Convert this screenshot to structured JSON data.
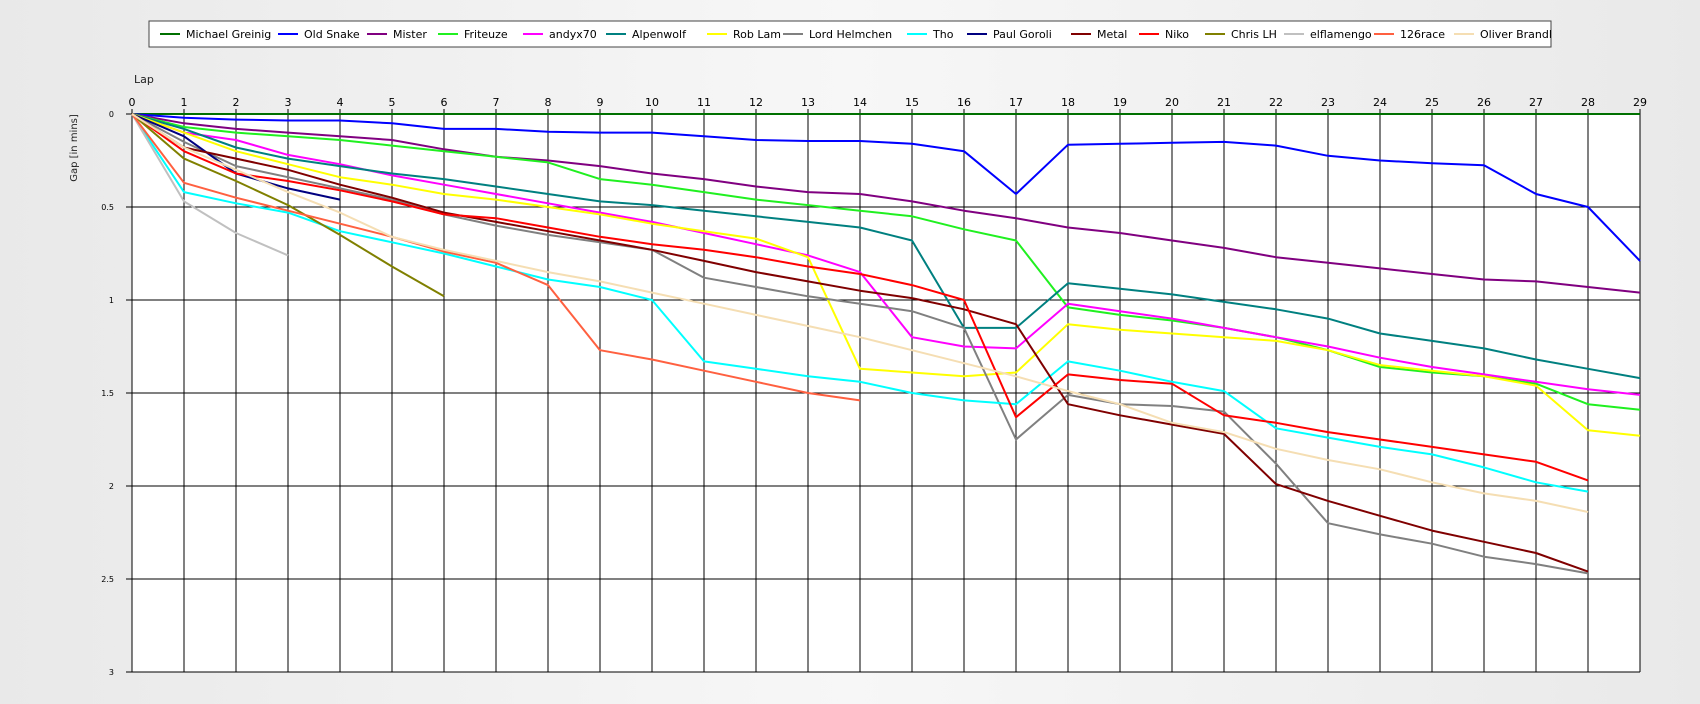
{
  "chart_data": {
    "type": "line",
    "title": "",
    "xlabel": "Lap",
    "ylabel": "Gap [in mins]",
    "xlim": [
      0,
      29
    ],
    "ylim": [
      0,
      3
    ],
    "y_inverted": true,
    "grid": true,
    "legend_position": "top",
    "x": [
      0,
      1,
      2,
      3,
      4,
      5,
      6,
      7,
      8,
      9,
      10,
      11,
      12,
      13,
      14,
      15,
      16,
      17,
      18,
      19,
      20,
      21,
      22,
      23,
      24,
      25,
      26,
      27,
      28,
      29
    ],
    "x_ticks": [
      "0",
      "1",
      "2",
      "3",
      "4",
      "5",
      "6",
      "7",
      "8",
      "9",
      "10",
      "11",
      "12",
      "13",
      "14",
      "15",
      "16",
      "17",
      "18",
      "19",
      "20",
      "21",
      "22",
      "23",
      "24",
      "25",
      "26",
      "27",
      "28",
      "29"
    ],
    "y_ticks": [
      {
        "value": 0,
        "label": "0"
      },
      {
        "value": 0.5,
        "label": "0.5"
      },
      {
        "value": 1,
        "label": "1"
      },
      {
        "value": 1.5,
        "label": "1.5"
      },
      {
        "value": 2,
        "label": "2"
      },
      {
        "value": 2.5,
        "label": "2.5"
      },
      {
        "value": 3,
        "label": "3"
      }
    ],
    "series": [
      {
        "name": "Michael Greinig",
        "color": "#007000",
        "values": [
          0,
          0,
          0,
          0,
          0,
          0,
          0,
          0,
          0,
          0,
          0,
          0,
          0,
          0,
          0,
          0,
          0,
          0,
          0,
          0,
          0,
          0,
          0,
          0,
          0,
          0,
          0,
          0,
          0,
          0
        ]
      },
      {
        "name": "Old Snake",
        "color": "#0000ff",
        "values": [
          0,
          0.02,
          0.03,
          0.035,
          0.035,
          0.05,
          0.08,
          0.08,
          0.095,
          0.1,
          0.1,
          0.12,
          0.14,
          0.145,
          0.145,
          0.16,
          0.2,
          0.43,
          0.165,
          0.16,
          0.155,
          0.15,
          0.17,
          0.225,
          0.25,
          0.265,
          0.275,
          0.43,
          0.5,
          0.79
        ]
      },
      {
        "name": "Mister",
        "color": "#800080",
        "values": [
          0,
          0.05,
          0.08,
          0.1,
          0.12,
          0.14,
          0.19,
          0.23,
          0.25,
          0.28,
          0.32,
          0.35,
          0.39,
          0.42,
          0.43,
          0.47,
          0.52,
          0.56,
          0.61,
          0.64,
          0.68,
          0.72,
          0.77,
          0.8,
          0.83,
          0.86,
          0.89,
          0.9,
          0.93,
          0.96
        ]
      },
      {
        "name": "Friteuze",
        "color": "#20f020",
        "values": [
          0,
          0.07,
          0.1,
          0.12,
          0.14,
          0.17,
          0.2,
          0.23,
          0.26,
          0.35,
          0.38,
          0.42,
          0.46,
          0.49,
          0.52,
          0.55,
          0.62,
          0.68,
          1.04,
          1.08,
          1.11,
          1.15,
          1.2,
          1.27,
          1.36,
          1.39,
          1.41,
          1.45,
          1.56,
          1.59
        ]
      },
      {
        "name": "andyx70",
        "color": "#ff00ff",
        "values": [
          0,
          0.1,
          0.14,
          0.22,
          0.27,
          0.33,
          0.38,
          0.43,
          0.48,
          0.53,
          0.58,
          0.64,
          0.7,
          0.76,
          0.85,
          1.2,
          1.25,
          1.26,
          1.02,
          1.06,
          1.1,
          1.15,
          1.2,
          1.25,
          1.31,
          1.36,
          1.4,
          1.44,
          1.48,
          1.51
        ]
      },
      {
        "name": "Alpenwolf",
        "color": "#008080",
        "values": [
          0,
          0.08,
          0.18,
          0.24,
          0.28,
          0.32,
          0.35,
          0.39,
          0.43,
          0.47,
          0.49,
          0.52,
          0.55,
          0.58,
          0.61,
          0.68,
          1.15,
          1.15,
          0.91,
          0.94,
          0.97,
          1.01,
          1.05,
          1.1,
          1.18,
          1.22,
          1.26,
          1.32,
          1.37,
          1.42
        ]
      },
      {
        "name": "Rob Lam",
        "color": "#ffff00",
        "values": [
          0,
          0.1,
          0.2,
          0.27,
          0.34,
          0.38,
          0.43,
          0.46,
          0.5,
          0.54,
          0.59,
          0.63,
          0.67,
          0.77,
          1.37,
          1.39,
          1.41,
          1.39,
          1.13,
          1.16,
          1.18,
          1.2,
          1.22,
          1.27,
          1.35,
          1.38,
          1.41,
          1.46,
          1.7,
          1.73
        ]
      },
      {
        "name": "Lord Helmchen",
        "color": "#808080",
        "values": [
          0,
          0.15,
          0.28,
          0.34,
          0.4,
          0.46,
          0.54,
          0.6,
          0.65,
          0.69,
          0.73,
          0.88,
          0.93,
          0.98,
          1.02,
          1.06,
          1.15,
          1.75,
          1.51,
          1.56,
          1.57,
          1.6,
          1.88,
          2.2,
          2.26,
          2.31,
          2.38,
          2.42,
          2.47,
          null
        ]
      },
      {
        "name": "Tho",
        "color": "#00ffff",
        "values": [
          0,
          0.42,
          0.48,
          0.53,
          0.63,
          0.69,
          0.75,
          0.82,
          0.89,
          0.93,
          1.0,
          1.33,
          1.37,
          1.41,
          1.44,
          1.5,
          1.54,
          1.56,
          1.33,
          1.38,
          1.44,
          1.49,
          1.69,
          1.74,
          1.79,
          1.83,
          1.9,
          1.98,
          2.03,
          null
        ]
      },
      {
        "name": "Paul Goroli",
        "color": "#000080",
        "values": [
          0,
          0.12,
          0.32,
          0.4,
          0.46,
          null,
          null,
          null,
          null,
          null,
          null,
          null,
          null,
          null,
          null,
          null,
          null,
          null,
          null,
          null,
          null,
          null,
          null,
          null,
          null,
          null,
          null,
          null,
          null,
          null
        ]
      },
      {
        "name": "Metal",
        "color": "#800000",
        "values": [
          0,
          0.18,
          0.24,
          0.3,
          0.38,
          0.45,
          0.53,
          0.58,
          0.63,
          0.68,
          0.73,
          0.79,
          0.85,
          0.9,
          0.95,
          0.99,
          1.05,
          1.13,
          1.56,
          1.62,
          1.67,
          1.72,
          1.99,
          2.08,
          2.16,
          2.24,
          2.3,
          2.36,
          2.46,
          null
        ]
      },
      {
        "name": "Niko",
        "color": "#ff0000",
        "values": [
          0,
          0.2,
          0.32,
          0.36,
          0.41,
          0.47,
          0.54,
          0.56,
          0.61,
          0.66,
          0.7,
          0.73,
          0.77,
          0.82,
          0.86,
          0.92,
          1.0,
          1.63,
          1.4,
          1.43,
          1.45,
          1.62,
          1.66,
          1.71,
          1.75,
          1.79,
          1.83,
          1.87,
          1.97,
          null
        ]
      },
      {
        "name": "Chris LH",
        "color": "#808000",
        "values": [
          0,
          0.24,
          0.36,
          0.49,
          0.65,
          0.82,
          0.98,
          null,
          null,
          null,
          null,
          null,
          null,
          null,
          null,
          null,
          null,
          null,
          null,
          null,
          null,
          null,
          null,
          null,
          null,
          null,
          null,
          null,
          null,
          null
        ]
      },
      {
        "name": "elflamengo",
        "color": "#c0c0c0",
        "values": [
          0,
          0.47,
          0.64,
          0.76,
          null,
          null,
          null,
          null,
          null,
          null,
          null,
          null,
          null,
          null,
          null,
          null,
          null,
          null,
          null,
          null,
          null,
          null,
          null,
          null,
          null,
          null,
          null,
          null,
          null,
          null
        ]
      },
      {
        "name": "126race",
        "color": "#ff6040",
        "values": [
          0,
          0.37,
          0.45,
          0.52,
          0.59,
          0.66,
          0.74,
          0.8,
          0.92,
          1.27,
          1.32,
          1.38,
          1.44,
          1.5,
          1.54,
          null,
          null,
          null,
          null,
          null,
          null,
          null,
          null,
          null,
          null,
          null,
          null,
          null,
          null,
          null
        ]
      },
      {
        "name": "Oliver Brandl",
        "color": "#f5deb3",
        "values": [
          0,
          0.18,
          0.3,
          0.42,
          0.53,
          0.66,
          0.73,
          0.79,
          0.85,
          0.9,
          0.96,
          1.02,
          1.08,
          1.14,
          1.2,
          1.27,
          1.34,
          1.41,
          1.49,
          1.56,
          1.66,
          1.71,
          1.8,
          1.86,
          1.91,
          1.98,
          2.04,
          2.08,
          2.14,
          null
        ]
      }
    ]
  }
}
